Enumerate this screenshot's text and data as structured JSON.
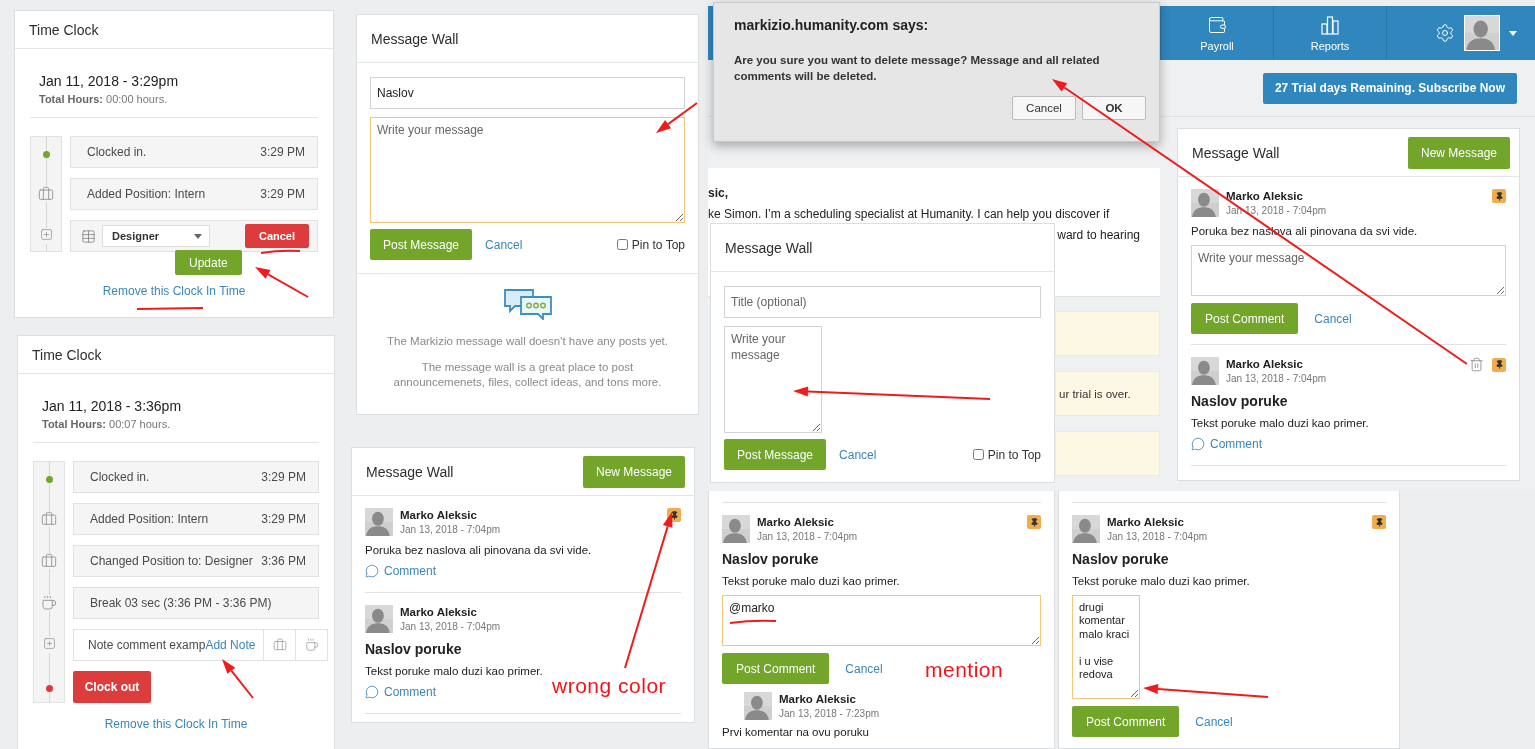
{
  "time_clock_panels": [
    {
      "title": "Time Clock",
      "date": "Jan 11, 2018 - 3:29pm",
      "total_label": "Total Hours:",
      "total_value": "00:00 hours.",
      "entries": [
        {
          "kind": "clock_in",
          "text": "Clocked in.",
          "time": "3:29 PM"
        },
        {
          "kind": "position",
          "text": "Added Position: Intern",
          "time": "3:29 PM"
        },
        {
          "kind": "edit",
          "value": "Designer",
          "cancel": "Cancel"
        }
      ],
      "update": "Update",
      "remove_link": "Remove this Clock In Time"
    },
    {
      "title": "Time Clock",
      "date": "Jan 11, 2018 - 3:36pm",
      "total_label": "Total Hours:",
      "total_value": "00:07 hours.",
      "entries": [
        {
          "kind": "clock_in",
          "text": "Clocked in.",
          "time": "3:29 PM"
        },
        {
          "kind": "position",
          "text": "Added Position: Intern",
          "time": "3:29 PM"
        },
        {
          "kind": "position",
          "text": "Changed Position to: Designer",
          "time": "3:36 PM"
        },
        {
          "kind": "break",
          "text": "Break 03 sec (3:36 PM - 3:36 PM)"
        },
        {
          "kind": "note",
          "text": "Note comment examp",
          "action": "Add Note"
        },
        {
          "kind": "clock_out",
          "text": "Clock out"
        }
      ],
      "remove_link": "Remove this Clock In Time"
    }
  ],
  "message_wall_form": {
    "title": "Message Wall",
    "title_value": "Naslov",
    "message_placeholder": "Write your message",
    "post": "Post Message",
    "cancel": "Cancel",
    "pin_label": "Pin to Top",
    "pin_checked": false,
    "empty_title": "The Markizio message wall doesn't have any posts yet.",
    "empty_text": "The message wall is a great place to post announcemenets, files, collect ideas, and tons more."
  },
  "message_wall_list": {
    "title": "Message Wall",
    "new_message": "New Message",
    "posts": [
      {
        "author": "Marko Aleksic",
        "date": "Jan 13, 2018 - 7:04pm",
        "text": "Poruka bez naslova ali pinovana da svi vide.",
        "pinned": true,
        "comment_link": "Comment"
      },
      {
        "author": "Marko Aleksic",
        "date": "Jan 13, 2018 - 7:04pm",
        "title": "Naslov poruke",
        "text": "Tekst poruke malo duzi kao primer.",
        "pinned": false,
        "comment_link": "Comment"
      }
    ]
  },
  "background_app": {
    "nav": [
      {
        "label": "Payroll"
      },
      {
        "label": "Reports"
      }
    ],
    "trial_button": "27 Trial days Remaining. Subscribe Now",
    "card_lines": [
      "sic,",
      "ke Simon. I’m a scheduling specialist at Humanity. I can help you discover if",
      "ward to hearing"
    ],
    "notices": [
      {
        "kind": "blank"
      },
      {
        "kind": "text",
        "text": "ur trial is over."
      },
      {
        "kind": "blank"
      }
    ],
    "message_wall": {
      "title": "Message Wall",
      "new_message": "New Message",
      "posts": [
        {
          "author": "Marko Aleksic",
          "date": "Jan 13, 2018 - 7:04pm",
          "text": "Poruka bez naslova ali pinovana da svi vide.",
          "pinned": true,
          "composer": {
            "kind": "wide",
            "placeholder": "Write your message",
            "focused": false,
            "post": "Post Comment",
            "cancel": "Cancel"
          }
        },
        {
          "author": "Marko Aleksic",
          "date": "Jan 13, 2018 - 7:04pm",
          "title": "Naslov poruke",
          "text": "Tekst poruke malo duzi kao primer.",
          "pinned": true,
          "deletable": true,
          "comment_link": "Comment"
        }
      ]
    }
  },
  "dialog": {
    "title": "markizio.humanity.com says:",
    "message": "Are you sure you want to delete message? Message and all related comments will be deleted.",
    "buttons": [
      {
        "label": "Cancel",
        "default": false
      },
      {
        "label": "OK",
        "default": true
      }
    ]
  },
  "compact_form": {
    "title": "Message Wall",
    "title_placeholder": "Title (optional)",
    "message_placeholder": "Write your message",
    "post": "Post Message",
    "cancel": "Cancel",
    "pin_label": "Pin to Top",
    "pin_checked": false
  },
  "thread_panels": [
    {
      "posts": [
        {
          "author": "Marko Aleksic",
          "date": "Jan 13, 2018 - 7:04pm",
          "title": "Naslov poruke",
          "text": "Tekst poruke malo duzi kao primer.",
          "pinned": true,
          "composer": {
            "kind": "wide",
            "value": "@marko",
            "focused": true,
            "post": "Post Comment",
            "cancel": "Cancel"
          },
          "replies": [
            {
              "author": "Marko Aleksic",
              "date": "Jan 13, 2018 - 7:23pm",
              "text": "Prvi komentar na ovu poruku"
            }
          ]
        }
      ]
    },
    {
      "posts": [
        {
          "author": "Marko Aleksic",
          "date": "Jan 13, 2018 - 7:04pm",
          "title": "Naslov poruke",
          "text": "Tekst poruke malo duzi kao primer.",
          "pinned": true,
          "composer": {
            "kind": "narrow",
            "value": "drugi komentar malo kraci\n\ni u vise redova",
            "focused": true,
            "post": "Post Comment",
            "cancel": "Cancel"
          }
        }
      ]
    }
  ],
  "annotations": {
    "labels": [
      {
        "text": "wrong color"
      },
      {
        "text": "mention"
      }
    ]
  }
}
